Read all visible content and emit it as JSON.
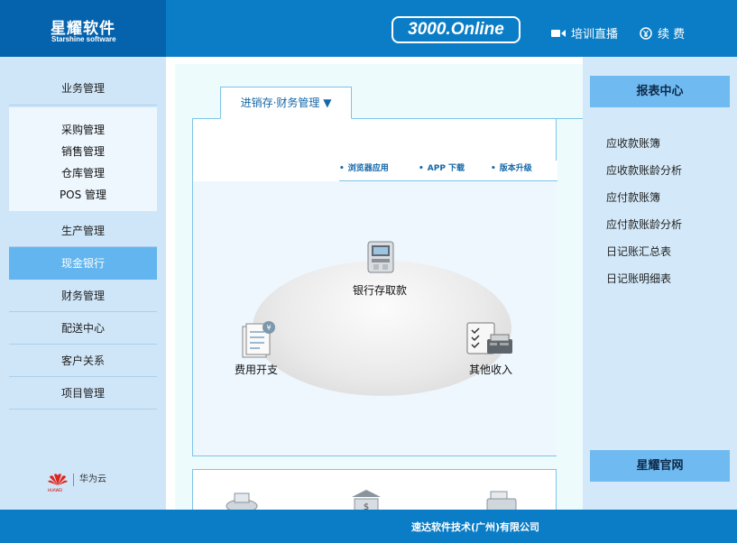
{
  "header": {
    "logo_title": "星耀软件",
    "logo_subtitle": "Starshine software",
    "online_badge": "3000.Online",
    "training_live": "培训直播",
    "renew": "续 费"
  },
  "sidebar": {
    "items": [
      {
        "label": "业务管理"
      },
      {
        "label": "生产管理"
      },
      {
        "label": "现金银行",
        "active": true
      },
      {
        "label": "财务管理"
      },
      {
        "label": "配送中心"
      },
      {
        "label": "客户关系"
      },
      {
        "label": "项目管理"
      }
    ],
    "submenu": [
      "采购管理",
      "销售管理",
      "仓库管理",
      "POS 管理"
    ],
    "huawei_cloud": "华为云",
    "huawei_brand": "HUAWEI"
  },
  "main": {
    "tab_label": "进销存·财务管理 ▼",
    "links": [
      "浏览器应用",
      "APP 下载",
      "版本升级"
    ],
    "nodes": [
      {
        "label": "银行存取款",
        "icon": "atm-icon"
      },
      {
        "label": "费用开支",
        "icon": "expense-document-icon"
      },
      {
        "label": "其他收入",
        "icon": "pos-terminal-icon"
      }
    ]
  },
  "report_center": {
    "title": "报表中心",
    "links": [
      "应收款账簿",
      "应收款账龄分析",
      "应付款账簿",
      "应付款账龄分析",
      "日记账汇总表",
      "日记账明细表"
    ],
    "official_site": "星耀官网"
  },
  "footer": {
    "company": "速达软件技术(广州)有限公司"
  },
  "colors": {
    "header_blue": "#0b7dc6",
    "logo_blue": "#0563ad",
    "active_item": "#62b5ee",
    "report_header": "#6fbaf0",
    "sidebar_bg": "#cfe6f8"
  }
}
